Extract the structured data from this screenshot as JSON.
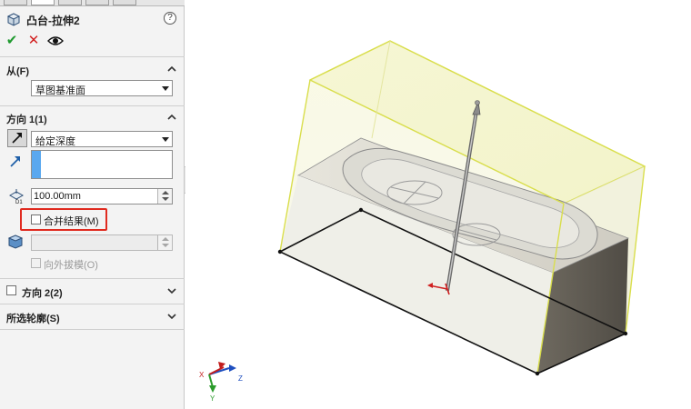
{
  "feature": {
    "title": "凸台-拉伸2",
    "help_label": "?"
  },
  "actions": {
    "ok_label": "✔",
    "cancel_label": "✕"
  },
  "from_group": {
    "label": "从(F)",
    "selected": "草图基准面"
  },
  "direction1": {
    "label": "方向 1(1)",
    "end_condition": "给定深度",
    "depth_value": "100.00mm",
    "merge_result_label": "合并结果(M)",
    "merge_result_checked": false,
    "draft_value": "",
    "draft_outward_label": "向外拔模(O)"
  },
  "direction2": {
    "label": "方向 2(2)",
    "checked": false
  },
  "selected_contours": {
    "label": "所选轮廓(S)"
  },
  "triad": {
    "x_label": "X",
    "y_label": "Y",
    "z_label": "Z"
  },
  "colors": {
    "ok": "#1f9a2f",
    "cancel": "#d21f1f",
    "highlight_box": "#e02b20",
    "selection_blue": "#5aa8ef",
    "extrude_preview": "#f4f4a8"
  }
}
